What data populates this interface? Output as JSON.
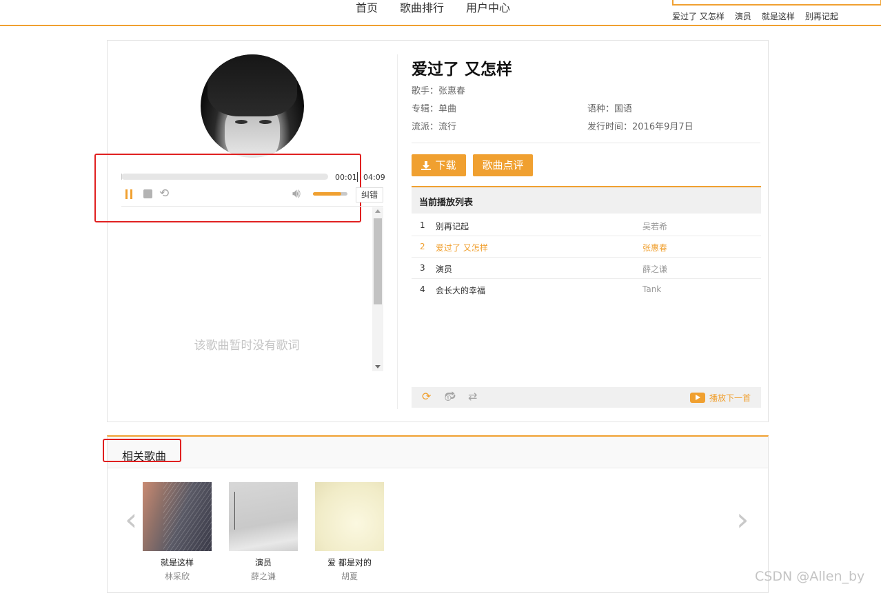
{
  "nav": {
    "items": [
      "首页",
      "歌曲排行",
      "用户中心"
    ]
  },
  "hot_songs": [
    "爱过了 又怎样",
    "演员",
    "就是这样",
    "别再记起"
  ],
  "player": {
    "current_time": "00:01",
    "total_time": "04:09",
    "progress": 0.004,
    "volume": 0.82,
    "report_label": "纠错",
    "no_lyrics": "该歌曲暂时没有歌词"
  },
  "song": {
    "title": "爱过了 又怎样",
    "singer": "歌手：张惠春",
    "album": "专辑：单曲",
    "genre": "流派：流行",
    "language": "语种：国语",
    "release": "发行时间：2016年9月7日",
    "download_label": "下载",
    "comment_label": "歌曲点评"
  },
  "playlist": {
    "title": "当前播放列表",
    "rows": [
      {
        "num": "1",
        "title": "别再记起",
        "artist": "吴若希",
        "active": false
      },
      {
        "num": "2",
        "title": "爱过了 又怎样",
        "artist": "张惠春",
        "active": true
      },
      {
        "num": "3",
        "title": "演员",
        "artist": "薛之谦",
        "active": false
      },
      {
        "num": "4",
        "title": "会长大的幸福",
        "artist": "Tank",
        "active": false
      }
    ],
    "play_next_label": "播放下一首"
  },
  "related": {
    "title": "相关歌曲",
    "songs": [
      {
        "name": "就是这样",
        "singer": "林采欣"
      },
      {
        "name": "演员",
        "singer": "薛之谦"
      },
      {
        "name": "爱 都是对的",
        "singer": "胡夏"
      }
    ]
  },
  "watermark": "CSDN @Allen_by",
  "colors": {
    "accent": "#f0a030",
    "annotation": "#e02020"
  }
}
